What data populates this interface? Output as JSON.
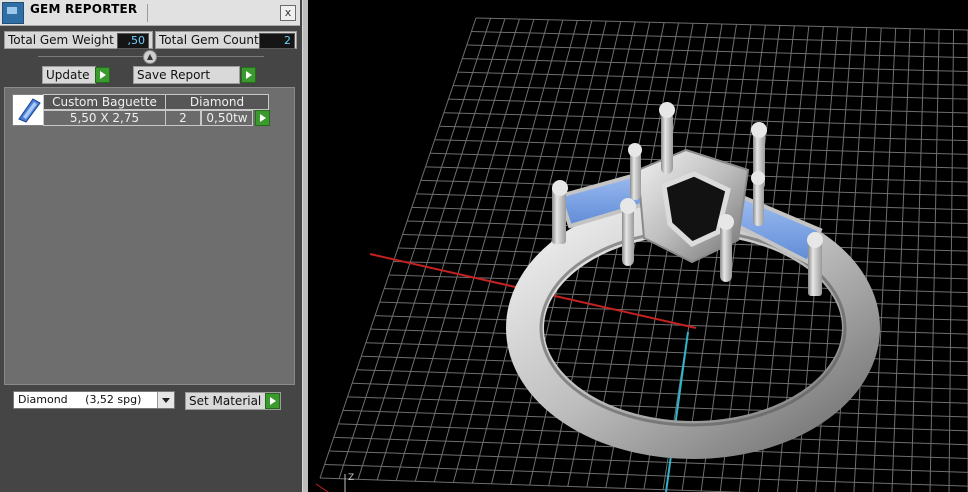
{
  "window": {
    "title": "GEM REPORTER",
    "close_label": "x"
  },
  "stats": {
    "total_weight_label": "Total Gem Weight",
    "total_weight_value": ",50",
    "total_count_label": "Total Gem Count",
    "total_count_value": "2"
  },
  "actions": {
    "update_label": "Update",
    "save_report_label": "Save Report"
  },
  "gem_table": {
    "rows": [
      {
        "name": "Custom Baguette",
        "material": "Diamond",
        "size": "5,50 X 2,75",
        "count": "2",
        "weight": "0,50tw"
      }
    ]
  },
  "material_select": {
    "selected": "Diamond     (3,52 spg)"
  },
  "set_material_label": "Set Material",
  "viewport": {
    "axis_label": "Z",
    "colors": {
      "x_axis": "#c42222",
      "z_axis": "#2fb6cc",
      "grid": "#6e6e6e",
      "gem": "#6f9be6",
      "metal": "#d4d4d4"
    }
  },
  "icons": [
    "app-icon",
    "close-icon",
    "collapse-icon",
    "gem-thumbnail-icon",
    "play-arrow-icon",
    "dropdown-arrow-icon"
  ]
}
